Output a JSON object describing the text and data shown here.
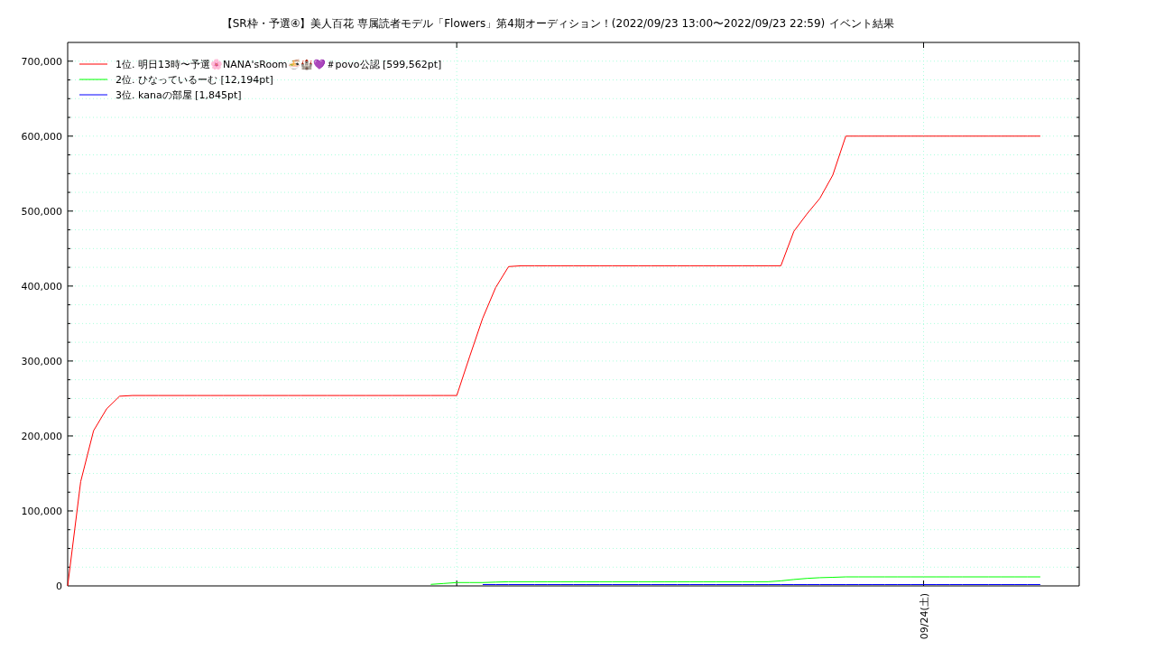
{
  "chart": {
    "result_label": "イベント結果",
    "chart_data": {
      "type": "line",
      "title": "【SR枠・予選④】美人百花 専属読者モデル「Flowers」第4期オーディション！(2022/09/23 13:00〜2022/09/23 22:59)",
      "series": [
        {
          "name": "1位. 明日13時〜予選🌸NANA'sRoom🍜🏰💜＃povo公認 [599,562pt]",
          "color": "#ff0000",
          "values": [
            0,
            139000,
            207000,
            236000,
            253000,
            254000,
            254000,
            254000,
            254000,
            254000,
            254000,
            254000,
            254000,
            254000,
            254000,
            254000,
            254000,
            254000,
            254000,
            254000,
            254000,
            254000,
            254000,
            254000,
            254000,
            254000,
            254000,
            254000,
            254000,
            254000,
            254000,
            306000,
            357000,
            398000,
            426000,
            427000,
            427000,
            427000,
            427000,
            427000,
            427000,
            427000,
            427000,
            427000,
            427000,
            427000,
            427000,
            427000,
            427000,
            427000,
            427000,
            427000,
            427000,
            427000,
            427000,
            427000,
            473000,
            496000,
            517000,
            548000,
            600000,
            600000,
            600000,
            600000,
            600000,
            600000,
            600000,
            600000,
            600000,
            600000,
            600000,
            600000,
            600000,
            600000,
            600000,
            600000,
            null,
            null,
            null
          ]
        },
        {
          "name": "2位. ひなっているーむ [12,194pt]",
          "color": "#00ff00",
          "values": [
            null,
            null,
            null,
            null,
            null,
            null,
            null,
            null,
            null,
            null,
            null,
            null,
            null,
            null,
            null,
            null,
            null,
            null,
            null,
            null,
            null,
            null,
            null,
            null,
            null,
            null,
            null,
            null,
            2000,
            3300,
            4500,
            4500,
            4500,
            5000,
            5500,
            5500,
            5500,
            5500,
            5500,
            5500,
            5500,
            5500,
            5500,
            5500,
            5500,
            5500,
            5500,
            5500,
            5500,
            5500,
            5500,
            5500,
            5500,
            5500,
            5500,
            6800,
            8600,
            10000,
            10900,
            11500,
            12000,
            12000,
            12000,
            12000,
            12000,
            12000,
            12000,
            12000,
            12000,
            12000,
            12000,
            12000,
            12000,
            12000,
            12000,
            12000,
            null,
            null,
            null
          ]
        },
        {
          "name": "3位. kanaの部屋 [1,845pt]",
          "color": "#0000ff",
          "values": [
            null,
            null,
            null,
            null,
            null,
            null,
            null,
            null,
            null,
            null,
            null,
            null,
            null,
            null,
            null,
            null,
            null,
            null,
            null,
            null,
            null,
            null,
            null,
            null,
            null,
            null,
            null,
            null,
            null,
            null,
            null,
            null,
            1800,
            1800,
            1800,
            1800,
            1800,
            1800,
            1800,
            1800,
            1800,
            1800,
            1800,
            1800,
            1800,
            1800,
            1800,
            1800,
            1800,
            1800,
            1800,
            1800,
            1800,
            1800,
            1800,
            1800,
            1800,
            1800,
            1800,
            1800,
            1800,
            1800,
            1800,
            1800,
            1800,
            1800,
            1800,
            1800,
            1800,
            1800,
            1800,
            1800,
            1800,
            1800,
            1800,
            1800,
            null,
            null,
            null
          ]
        }
      ],
      "ylim": [
        0,
        725000
      ],
      "grid": true,
      "legend": true,
      "annotations": [
        "09/24(土)"
      ],
      "yticks": [
        {
          "value": 0,
          "label": "0"
        },
        {
          "value": 100000,
          "label": "100,000"
        },
        {
          "value": 200000,
          "label": "200,000"
        },
        {
          "value": 300000,
          "label": "300,000"
        },
        {
          "value": 400000,
          "label": "400,000"
        },
        {
          "value": 500000,
          "label": "500,000"
        },
        {
          "value": 600000,
          "label": "600,000"
        },
        {
          "value": 700000,
          "label": "700,000"
        }
      ]
    }
  }
}
